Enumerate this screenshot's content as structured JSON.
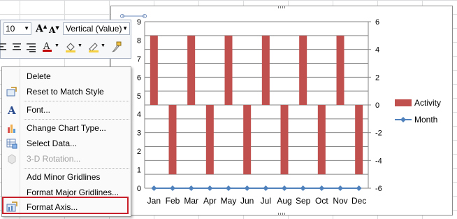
{
  "mini_toolbar": {
    "font_size": "10",
    "grow_font_label": "A",
    "shrink_font_label": "A",
    "axis_selector": "Vertical (Value)",
    "font_color": "#c00000"
  },
  "context_menu": {
    "items": [
      {
        "label": "Delete",
        "enabled": true,
        "icon": "none"
      },
      {
        "label": "Reset to Match Style",
        "enabled": true,
        "icon": "reset-style-icon"
      },
      {
        "label": "Font...",
        "enabled": true,
        "icon": "font-icon"
      },
      {
        "label": "Change Chart Type...",
        "enabled": true,
        "icon": "chart-type-icon"
      },
      {
        "label": "Select Data...",
        "enabled": true,
        "icon": "select-data-icon"
      },
      {
        "label": "3-D Rotation...",
        "enabled": false,
        "icon": "rotation-3d-icon"
      },
      {
        "label": "Add Minor Gridlines",
        "enabled": true,
        "icon": "none"
      },
      {
        "label": "Format Major Gridlines...",
        "enabled": true,
        "icon": "none"
      },
      {
        "label": "Format Axis...",
        "enabled": true,
        "icon": "format-axis-icon",
        "highlighted": true
      }
    ]
  },
  "chart_data": {
    "type": "bar",
    "categories": [
      "Jan",
      "Feb",
      "Mar",
      "Apr",
      "May",
      "Jun",
      "Jul",
      "Aug",
      "Sep",
      "Oct",
      "Nov",
      "Dec"
    ],
    "series": [
      {
        "name": "Activity",
        "type": "bar",
        "axis": "secondary",
        "color": "#c0504d",
        "values": [
          5,
          -5,
          5,
          -5,
          5,
          -5,
          5,
          -5,
          5,
          -5,
          5,
          -5
        ]
      },
      {
        "name": "Month",
        "type": "line",
        "axis": "secondary",
        "color": "#4f81bd",
        "values": [
          -6,
          -6,
          -6,
          -6,
          -6,
          -6,
          -6,
          -6,
          -6,
          -6,
          -6,
          -6
        ]
      }
    ],
    "primary_y_tick_labels": [
      "0",
      "1",
      "2",
      "3",
      "4",
      "5",
      "6",
      "7",
      "8",
      "9"
    ],
    "secondary_y_ticks": [
      "6",
      "4",
      "2",
      "0",
      "-2",
      "-4",
      "-6"
    ],
    "secondary_ylim": [
      -6,
      6
    ],
    "grid": true,
    "legend": "right",
    "title": "",
    "xlabel": "",
    "ylabel": ""
  }
}
